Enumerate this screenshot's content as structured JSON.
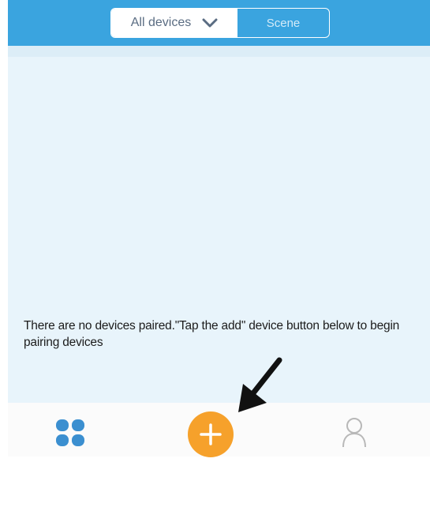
{
  "header": {
    "segment_left_label": "All devices",
    "segment_right_label": "Scene",
    "accent_color": "#3aa4df"
  },
  "main": {
    "empty_message": "There are no devices paired.\"Tap the add\" device button below to begin pairing devices"
  },
  "tabbar": {
    "devices_icon": "grid-icon",
    "add_icon": "plus-icon",
    "profile_icon": "user-icon",
    "add_color": "#f6a12b"
  }
}
